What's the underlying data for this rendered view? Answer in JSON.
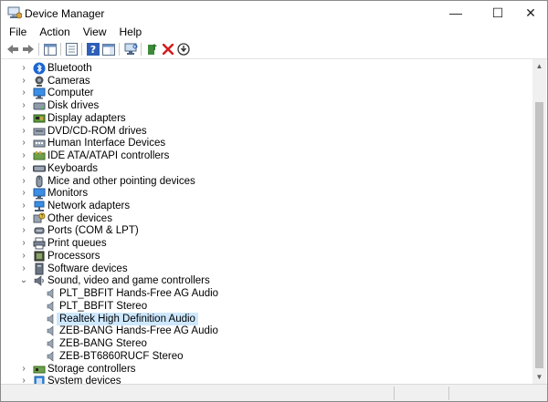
{
  "window": {
    "title": "Device Manager",
    "controls": {
      "minimize": "—",
      "maximize": "☐",
      "close": "✕"
    }
  },
  "menu": [
    "File",
    "Action",
    "View",
    "Help"
  ],
  "toolbar": {
    "buttons": [
      "back",
      "forward",
      "show-hide-console-tree",
      "properties-sheet",
      "help",
      "action-pane",
      "scan-for-hardware-changes",
      "update-driver",
      "uninstall-device",
      "disable-device"
    ]
  },
  "tree": [
    {
      "label": "Bluetooth",
      "icon": "bluetooth-icon",
      "expander": "›",
      "level": 0
    },
    {
      "label": "Cameras",
      "icon": "camera-icon",
      "expander": "›",
      "level": 0
    },
    {
      "label": "Computer",
      "icon": "computer-icon",
      "expander": "›",
      "level": 0
    },
    {
      "label": "Disk drives",
      "icon": "disk-drive-icon",
      "expander": "›",
      "level": 0
    },
    {
      "label": "Display adapters",
      "icon": "display-adapter-icon",
      "expander": "›",
      "level": 0
    },
    {
      "label": "DVD/CD-ROM drives",
      "icon": "dvd-drive-icon",
      "expander": "›",
      "level": 0
    },
    {
      "label": "Human Interface Devices",
      "icon": "hid-icon",
      "expander": "›",
      "level": 0
    },
    {
      "label": "IDE ATA/ATAPI controllers",
      "icon": "ide-controller-icon",
      "expander": "›",
      "level": 0
    },
    {
      "label": "Keyboards",
      "icon": "keyboard-icon",
      "expander": "›",
      "level": 0
    },
    {
      "label": "Mice and other pointing devices",
      "icon": "mouse-icon",
      "expander": "›",
      "level": 0
    },
    {
      "label": "Monitors",
      "icon": "monitor-icon",
      "expander": "›",
      "level": 0
    },
    {
      "label": "Network adapters",
      "icon": "network-adapter-icon",
      "expander": "›",
      "level": 0
    },
    {
      "label": "Other devices",
      "icon": "other-devices-icon",
      "expander": "›",
      "level": 0
    },
    {
      "label": "Ports (COM & LPT)",
      "icon": "port-icon",
      "expander": "›",
      "level": 0
    },
    {
      "label": "Print queues",
      "icon": "printer-icon",
      "expander": "›",
      "level": 0
    },
    {
      "label": "Processors",
      "icon": "processor-icon",
      "expander": "›",
      "level": 0
    },
    {
      "label": "Software devices",
      "icon": "software-device-icon",
      "expander": "›",
      "level": 0
    },
    {
      "label": "Sound, video and game controllers",
      "icon": "sound-icon",
      "expander": "⌄",
      "level": 0
    },
    {
      "label": "PLT_BBFIT Hands-Free AG Audio",
      "icon": "speaker-icon",
      "expander": "",
      "level": 1
    },
    {
      "label": "PLT_BBFIT Stereo",
      "icon": "speaker-icon",
      "expander": "",
      "level": 1
    },
    {
      "label": "Realtek High Definition Audio",
      "icon": "speaker-icon",
      "expander": "",
      "level": 1,
      "selected": true
    },
    {
      "label": "ZEB-BANG Hands-Free AG Audio",
      "icon": "speaker-icon",
      "expander": "",
      "level": 1
    },
    {
      "label": "ZEB-BANG Stereo",
      "icon": "speaker-icon",
      "expander": "",
      "level": 1
    },
    {
      "label": "ZEB-BT6860RUCF Stereo",
      "icon": "speaker-icon",
      "expander": "",
      "level": 1
    },
    {
      "label": "Storage controllers",
      "icon": "storage-controller-icon",
      "expander": "›",
      "level": 0
    },
    {
      "label": "System devices",
      "icon": "system-device-icon",
      "expander": "›",
      "level": 0
    }
  ],
  "colors": {
    "selection": "#cde8ff",
    "accent": "#1e6fd9"
  }
}
